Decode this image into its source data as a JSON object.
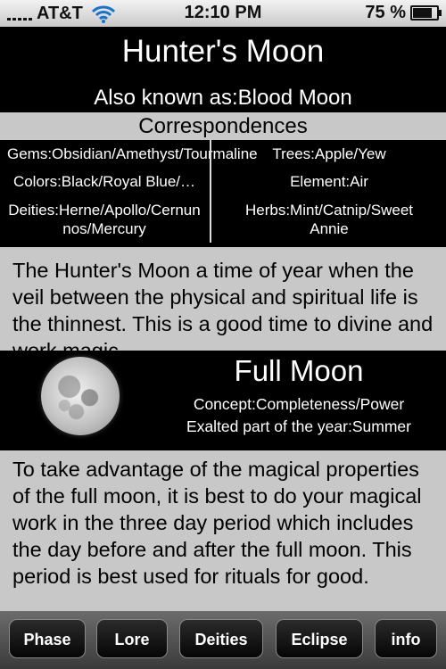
{
  "status_bar": {
    "carrier": "AT&T",
    "time": "12:10 PM",
    "battery": "75 %",
    "battery_level": 0.75
  },
  "header": {
    "title": "Hunter's Moon",
    "also_known_as": "Also known as:Blood Moon"
  },
  "correspondences": {
    "heading": "Correspondences",
    "left": {
      "gems": "Gems:Obsidian/Amethyst/Tourmaline",
      "colors": "Colors:Black/Royal Blue/…",
      "deities": "Deities:Herne/Apollo/Cernunnos/Mercury"
    },
    "right": {
      "trees": "Trees:Apple/Yew",
      "element": "Element:Air",
      "herbs": "Herbs:Mint/Catnip/Sweet Annie"
    }
  },
  "lore_text": "The Hunter's Moon a time of year when the veil between the physical and spiritual life is the thinnest. This is a good time to divine and work magic.",
  "phase": {
    "name": "Full Moon",
    "concept": "Concept:Completeness/Power",
    "exalted": "Exalted part of the year:Summer",
    "text": "To take advantage of the magical properties of the full moon, it is best to do your magical work in the three day period which includes the day before and after the full moon. This period is best used for rituals for good."
  },
  "tabs": {
    "phase": "Phase",
    "lore": "Lore",
    "deities": "Deities",
    "eclipse": "Eclipse",
    "info": "info"
  }
}
